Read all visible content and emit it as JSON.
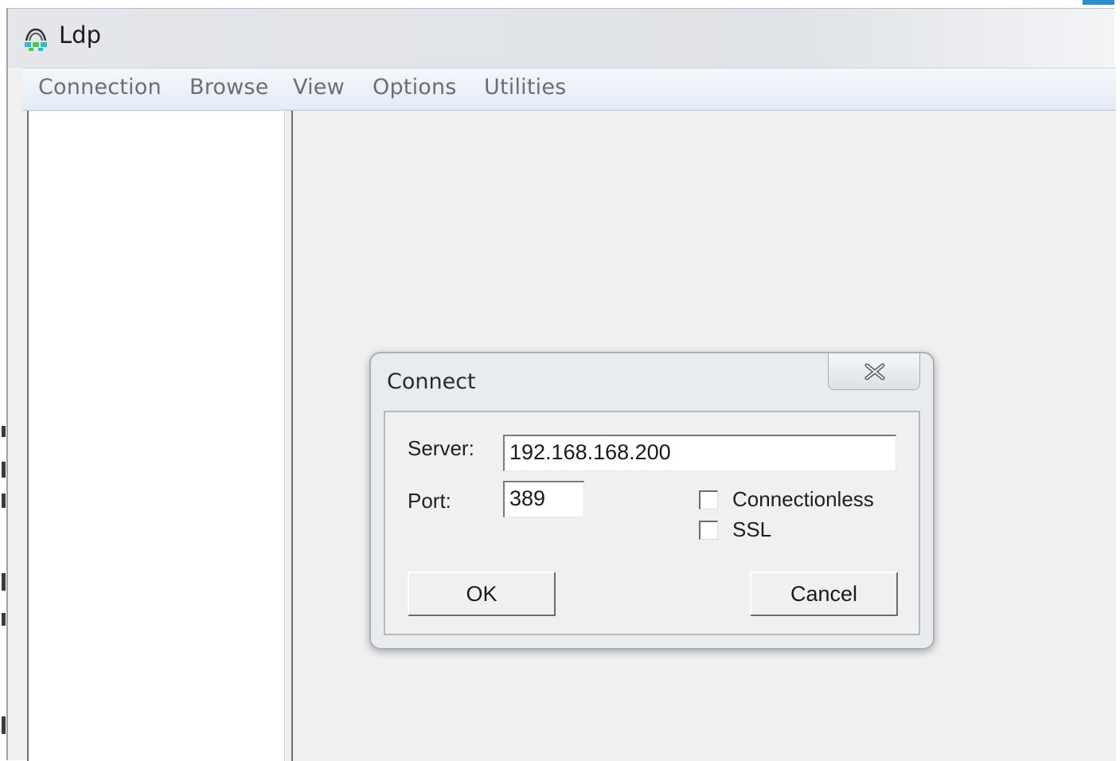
{
  "window": {
    "title": "Ldp",
    "icon": "ldp-app-icon"
  },
  "menu": {
    "items": [
      "Connection",
      "Browse",
      "View",
      "Options",
      "Utilities"
    ]
  },
  "dialog": {
    "title": "Connect",
    "close_icon": "close-icon",
    "server_label": "Server:",
    "server_value": "192.168.168.200",
    "port_label": "Port:",
    "port_value": "389",
    "connectionless_label": "Connectionless",
    "connectionless_checked": false,
    "ssl_label": "SSL",
    "ssl_checked": false,
    "ok_label": "OK",
    "cancel_label": "Cancel"
  },
  "colors": {
    "window_bg": "#f0f0f0",
    "menubar_bg": "#e3ebf6",
    "accent": "#2f8dc9"
  }
}
